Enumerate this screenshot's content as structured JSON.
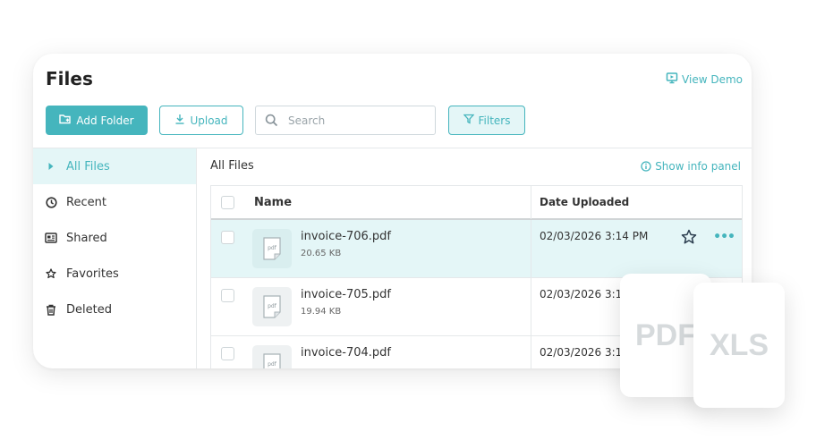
{
  "header": {
    "title": "Files",
    "view_demo": "View Demo"
  },
  "toolbar": {
    "add_folder": "Add Folder",
    "upload": "Upload",
    "search_placeholder": "Search",
    "filters": "Filters"
  },
  "sidebar": {
    "items": [
      {
        "label": "All Files",
        "icon": "caret-right-icon",
        "active": true
      },
      {
        "label": "Recent",
        "icon": "clock-icon"
      },
      {
        "label": "Shared",
        "icon": "shared-card-icon"
      },
      {
        "label": "Favorites",
        "icon": "star-icon"
      },
      {
        "label": "Deleted",
        "icon": "trash-icon"
      }
    ]
  },
  "main": {
    "breadcrumb": "All Files",
    "info_panel": "Show info panel",
    "columns": {
      "name": "Name",
      "date": "Date Uploaded"
    },
    "rows": [
      {
        "name": "invoice-706.pdf",
        "size": "20.65 KB",
        "date": "02/03/2026 3:14 PM",
        "thumb": "pdf",
        "selected": true
      },
      {
        "name": "invoice-705.pdf",
        "size": "19.94 KB",
        "date": "02/03/2026 3:1",
        "thumb": "pdf"
      },
      {
        "name": "invoice-704.pdf",
        "size": "",
        "date": "02/03/2026 3:1",
        "thumb": "pdf"
      }
    ]
  },
  "floating": {
    "pdf_label": "PDF",
    "xls_label": "XLS"
  },
  "colors": {
    "accent": "#45b5bd",
    "selected_bg": "#e4f6f7"
  }
}
